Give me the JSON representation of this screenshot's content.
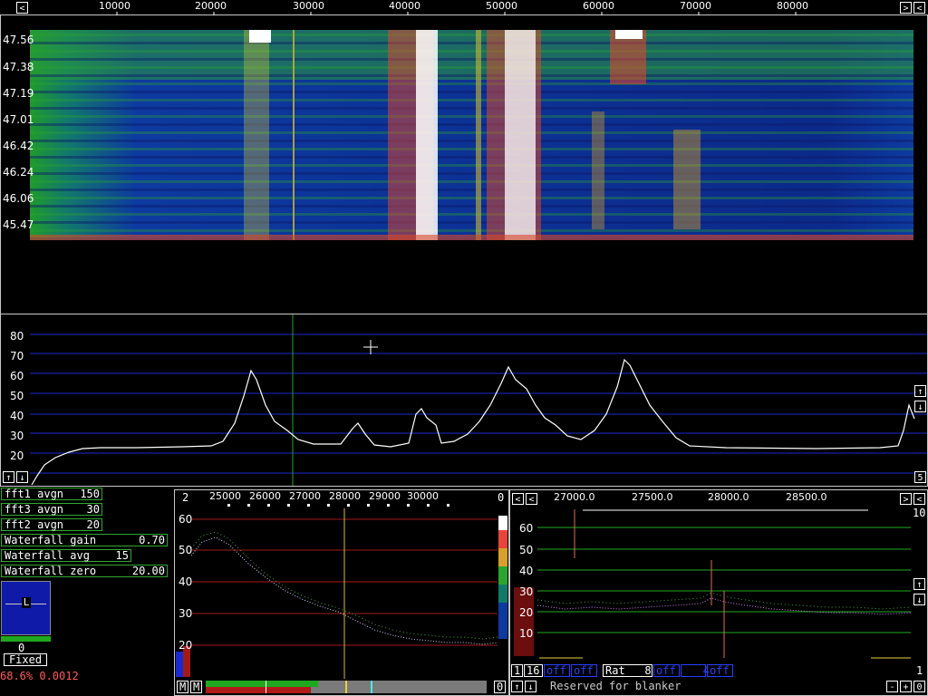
{
  "top_ruler": {
    "left_arrow": "<",
    "right_arrows": [
      ">",
      "<"
    ],
    "labels": [
      "10000",
      "20000",
      "30000",
      "40000",
      "50000",
      "60000",
      "70000",
      "80000"
    ]
  },
  "waterfall": {
    "time_labels": [
      "47.56",
      "47.38",
      "47.19",
      "47.01",
      "46.42",
      "46.24",
      "46.06",
      "45.47"
    ]
  },
  "spectrum": {
    "y_labels": [
      "80",
      "70",
      "60",
      "50",
      "40",
      "30",
      "20"
    ],
    "up_arrow": "↑",
    "down_arrow": "↓",
    "right_value": "5"
  },
  "params": [
    {
      "label": "fft1 avgn",
      "value": "150"
    },
    {
      "label": "fft3 avgn",
      "value": "30"
    },
    {
      "label": "fft2 avgn",
      "value": "20"
    },
    {
      "label": "Waterfall gain",
      "value": "0.70"
    },
    {
      "label": "Waterfall avg",
      "value": "15"
    },
    {
      "label": "Waterfall zero",
      "value": "20.00"
    }
  ],
  "meter": {
    "l_label": "L",
    "value": "0",
    "mode": "Fixed"
  },
  "status_readout": "68.6% 0.0012",
  "baseband": {
    "left_value": "2",
    "freq_labels": [
      "25000",
      "26000",
      "27000",
      "28000",
      "29000",
      "30000"
    ],
    "right_value": "0",
    "y_labels": [
      "60",
      "50",
      "40",
      "30",
      "20"
    ],
    "m_buttons": [
      "M",
      "M"
    ],
    "zero_button": "0"
  },
  "hires": {
    "freq_labels": [
      "27000.0",
      "27500.0",
      "28000.0",
      "28500.0"
    ],
    "right_top": "10",
    "right_bottom": "1",
    "y_labels": [
      "60",
      "50",
      "40",
      "30",
      "20",
      "10"
    ],
    "controls": [
      {
        "kind": "white",
        "text": "1"
      },
      {
        "kind": "white",
        "text": "16"
      },
      {
        "kind": "blue",
        "text": "off"
      },
      {
        "kind": "blue",
        "text": "off"
      },
      {
        "kind": "white",
        "text": "Rat   8"
      },
      {
        "kind": "blue",
        "text": "off"
      },
      {
        "kind": "blue",
        "text": "   4"
      },
      {
        "kind": "blue",
        "text": "off"
      }
    ],
    "blanker_text": "Reserved for blanker",
    "bottom_buttons": [
      "-",
      "+",
      "0"
    ]
  },
  "colors": {
    "grid_blue": "#1a2ad0",
    "grid_green": "#1faa1f",
    "grid_red": "#a01a1a",
    "param_border": "#2ea82e",
    "readout": "#ff5a5a"
  }
}
